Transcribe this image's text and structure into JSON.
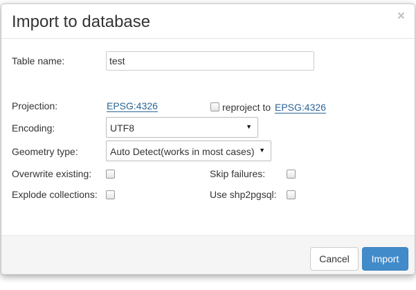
{
  "dialog": {
    "title": "Import to database",
    "close_symbol": "×"
  },
  "form": {
    "table_name": {
      "label": "Table name:",
      "value": "test"
    },
    "projection": {
      "label": "Projection:",
      "value": "EPSG:4326",
      "reproject_label": "reproject to",
      "reproject_target": "EPSG:4326",
      "reproject_checked": false
    },
    "encoding": {
      "label": "Encoding:",
      "selected": "UTF8"
    },
    "geometry_type": {
      "label": "Geometry type:",
      "selected": "Auto Detect(works in most cases)"
    },
    "overwrite_existing": {
      "label": "Overwrite existing:",
      "checked": false
    },
    "skip_failures": {
      "label": "Skip failures:",
      "checked": false
    },
    "explode_collections": {
      "label": "Explode collections:",
      "checked": false
    },
    "use_shp2pgsql": {
      "label": "Use shp2pgsql:",
      "checked": false
    }
  },
  "footer": {
    "cancel_label": "Cancel",
    "import_label": "Import",
    "primary_color": "#428bca"
  },
  "icons": {
    "dropdown": "caret-down-icon",
    "close": "close-icon"
  }
}
